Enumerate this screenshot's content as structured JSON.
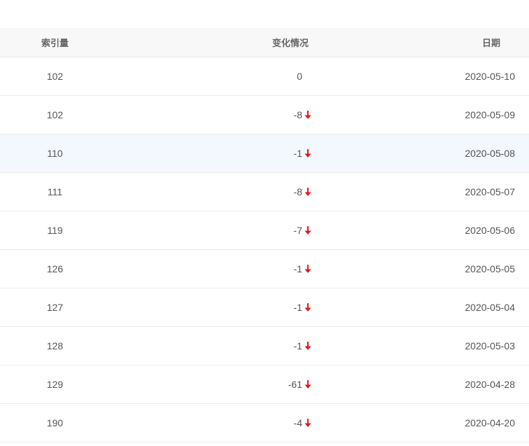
{
  "table": {
    "headers": {
      "index_count": "索引量",
      "change": "变化情况",
      "date": "日期"
    },
    "rows": [
      {
        "index_count": "102",
        "change": "0",
        "direction": "none",
        "date": "2020-05-10"
      },
      {
        "index_count": "102",
        "change": "-8",
        "direction": "down",
        "date": "2020-05-09"
      },
      {
        "index_count": "110",
        "change": "-1",
        "direction": "down",
        "date": "2020-05-08",
        "highlighted": true
      },
      {
        "index_count": "111",
        "change": "-8",
        "direction": "down",
        "date": "2020-05-07"
      },
      {
        "index_count": "119",
        "change": "-7",
        "direction": "down",
        "date": "2020-05-06"
      },
      {
        "index_count": "126",
        "change": "-1",
        "direction": "down",
        "date": "2020-05-05"
      },
      {
        "index_count": "127",
        "change": "-1",
        "direction": "down",
        "date": "2020-05-04"
      },
      {
        "index_count": "128",
        "change": "-1",
        "direction": "down",
        "date": "2020-05-03"
      },
      {
        "index_count": "129",
        "change": "-61",
        "direction": "down",
        "date": "2020-04-28"
      },
      {
        "index_count": "190",
        "change": "-4",
        "direction": "down",
        "date": "2020-04-20"
      }
    ]
  },
  "colors": {
    "down_arrow": "#e8141b",
    "highlight_row": "#f3f7fe",
    "header_bg": "#f8f8f8"
  },
  "icons": {
    "down": "arrow-down-icon"
  }
}
